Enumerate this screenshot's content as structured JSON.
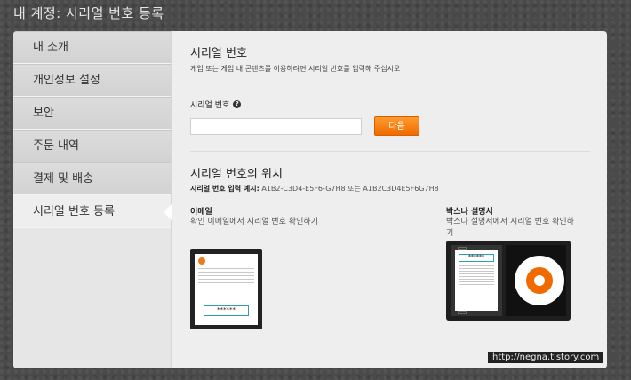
{
  "page_title": "내 계정: 시리얼 번호 등록",
  "sidebar": {
    "items": [
      {
        "label": "내 소개"
      },
      {
        "label": "개인정보 설정"
      },
      {
        "label": "보안"
      },
      {
        "label": "주문 내역"
      },
      {
        "label": "결제 및 배송"
      },
      {
        "label": "시리얼 번호 등록",
        "active": true
      }
    ]
  },
  "form": {
    "title": "시리얼 번호",
    "description": "게임 또는 게임 내 콘텐츠를 이용하려면 시리얼 번호를 입력해 주십시오",
    "field_label": "시리얼 번호",
    "help_icon": "?",
    "input_value": "",
    "next_button": "다음"
  },
  "location": {
    "title": "시리얼 번호의 위치",
    "example_label": "시리얼 번호 입력 예시:",
    "example_value": "A1B2-C3D4-E5F6-G7H8 또는 A1B2C3D4E5F6G7H8",
    "email": {
      "title": "이메일",
      "desc": "확인 이메일에서 시리얼 번호 확인하기",
      "code_mask": "******"
    },
    "box": {
      "title": "박스나 설명서",
      "desc": "박스나 설명서에서 시리얼 번호 확인하기",
      "code_mask": "******"
    }
  },
  "watermark": "http://negna.tistory.com",
  "colors": {
    "accent": "#f07a1a",
    "code_border": "#2c9fb0"
  }
}
